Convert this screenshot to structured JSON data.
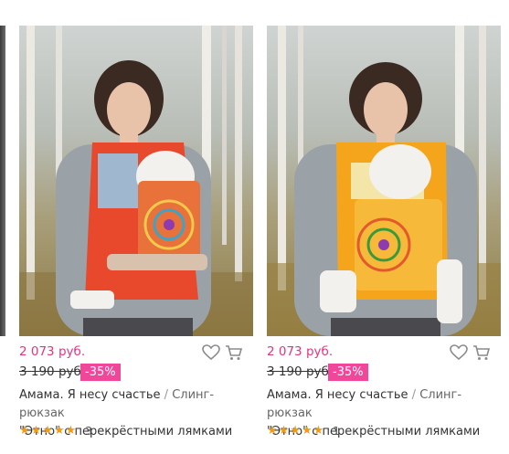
{
  "products": [
    {
      "price": "2 073 руб.",
      "old_price": "3 190 руб.",
      "discount": "-35%",
      "brand": "Амама. Я несу счастье",
      "separator": "/",
      "category": "Слинг-рюкзак",
      "name": "\"Этно\" с перекрёстными лямками",
      "stars": "★★★★★",
      "rating_value": 5,
      "review_count": "3",
      "carrier_color": "#e8482b",
      "panel_color": "#e8723a",
      "accent_color": "#9fb8cf"
    },
    {
      "price": "2 073 руб.",
      "old_price": "3 190 руб.",
      "discount": "-35%",
      "brand": "Амама. Я несу счастье",
      "separator": "/",
      "category": "Слинг-рюкзак",
      "name": "\"Этно\" с перекрёстными лямками",
      "stars": "★★★★★",
      "rating_value": 5,
      "review_count": "1",
      "carrier_color": "#f5a51c",
      "panel_color": "#f7b93a",
      "accent_color": "#f3e6a8"
    }
  ],
  "icons": [
    "heart-icon",
    "cart-icon"
  ],
  "colors": {
    "price": "#e2357f",
    "discount_bg": "#f0479b",
    "stars": "#f09a1a"
  }
}
